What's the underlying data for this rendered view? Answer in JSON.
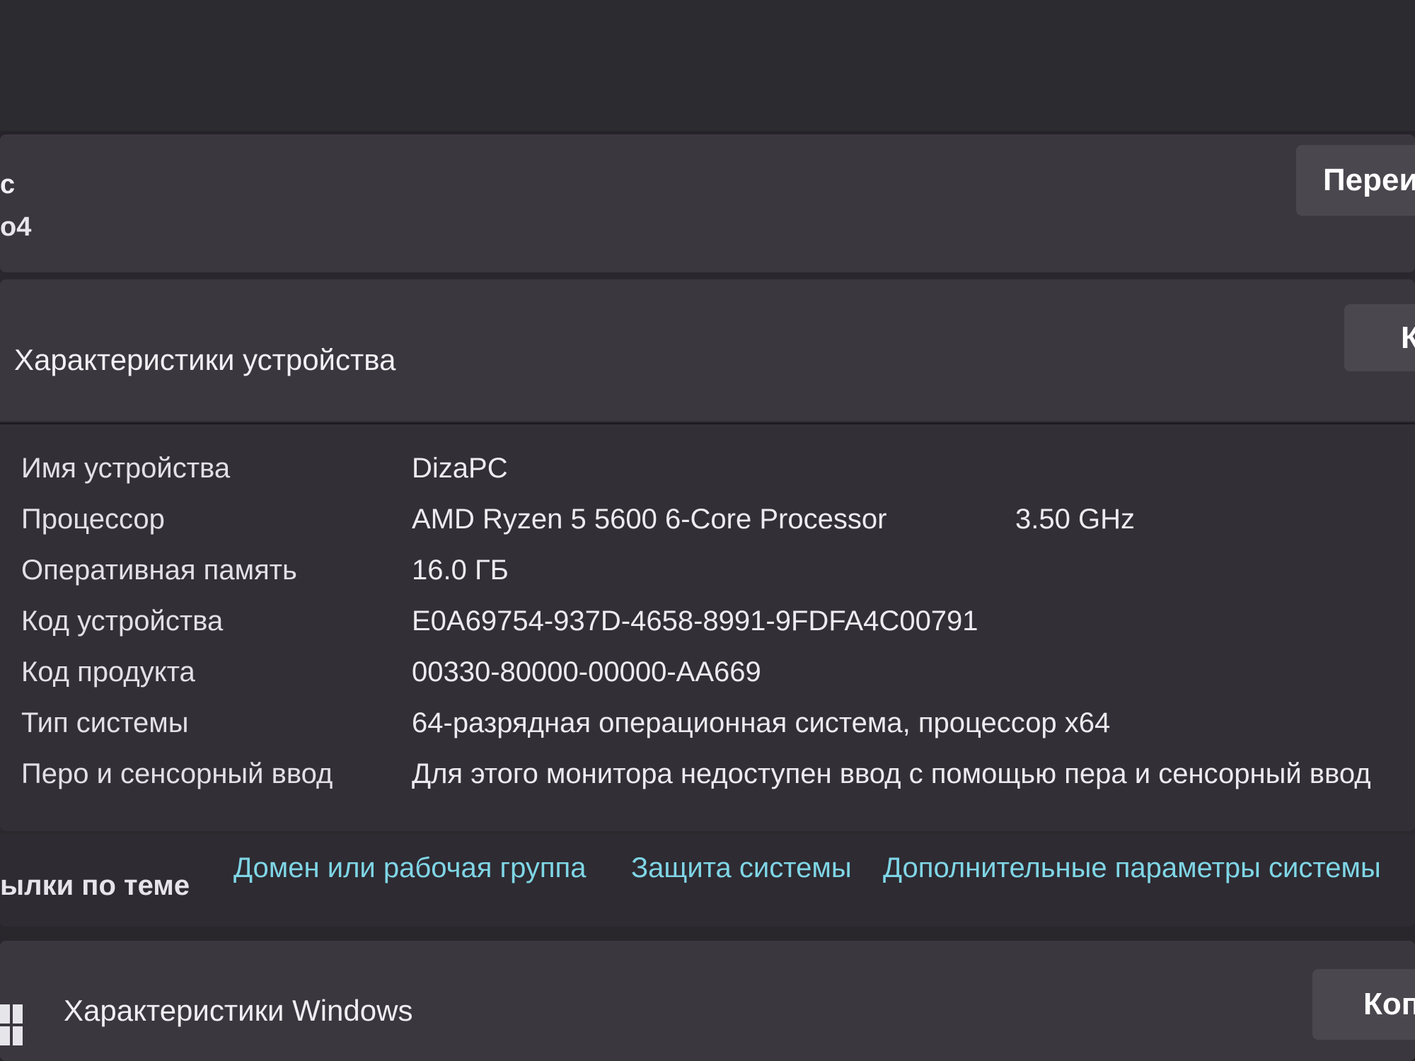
{
  "pc_card": {
    "title_fragment": "с",
    "subtitle_fragment": "o4",
    "rename_button": "Переи"
  },
  "device_specs": {
    "title": "Характеристики устройства",
    "copy_button": "К",
    "rows": [
      {
        "label": "Имя устройства",
        "value": "DizaPC",
        "extra": ""
      },
      {
        "label": "Процессор",
        "value": "AMD Ryzen 5 5600 6-Core Processor",
        "extra": "3.50 GHz"
      },
      {
        "label": "Оперативная память",
        "value": "16.0 ГБ",
        "extra": ""
      },
      {
        "label": "Код устройства",
        "value": "E0A69754-937D-4658-8991-9FDFA4C00791",
        "extra": ""
      },
      {
        "label": "Код продукта",
        "value": "00330-80000-00000-AA669",
        "extra": ""
      },
      {
        "label": "Тип системы",
        "value": "64-разрядная операционная система, процессор x64",
        "extra": ""
      },
      {
        "label": "Перо и сенсорный ввод",
        "value": "Для этого монитора недоступен ввод с помощью пера и сенсорный ввод",
        "extra": ""
      }
    ]
  },
  "related_links": {
    "label": "ылки по теме",
    "links": [
      "Домен или рабочая группа",
      "Защита системы",
      "Дополнительные параметры системы"
    ]
  },
  "windows_specs": {
    "icon": "windows-logo-icon",
    "title": "Характеристики Windows",
    "copy_button": "Коп"
  }
}
